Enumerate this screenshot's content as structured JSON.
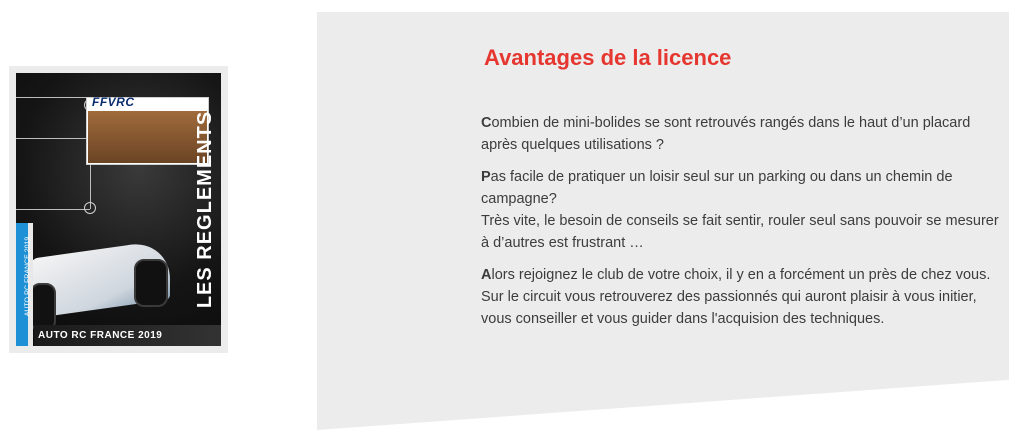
{
  "cover": {
    "logo": "FFVRC",
    "vertical_title": "LES REGLEMENTS",
    "side_label": "AUTO RC FRANCE 2019",
    "bottom_label": "AUTO RC FRANCE 2019"
  },
  "section": {
    "title": "Avantages de la licence",
    "paragraphs": [
      {
        "initial": "C",
        "text": "ombien de mini-bolides se sont retrouvés rangés dans le haut d’un placard après quelques utilisations ?"
      },
      {
        "initial": "P",
        "text": "as facile de pratiquer un loisir seul sur un parking ou dans un chemin de campagne?",
        "text2": "Très vite, le besoin de conseils se fait sentir, rouler seul sans pouvoir se mesurer à d’autres est frustrant …"
      },
      {
        "initial": "A",
        "text": "lors rejoignez le club de votre choix, il y en a forcément un près de chez vous. Sur le circuit vous retrouverez des passionnés qui auront plaisir à vous initier, vous conseiller et vous guider dans l'acquision des techniques."
      }
    ]
  },
  "colors": {
    "accent": "#e63630",
    "panel_bg": "#ececec",
    "text": "#3c3c3c"
  }
}
